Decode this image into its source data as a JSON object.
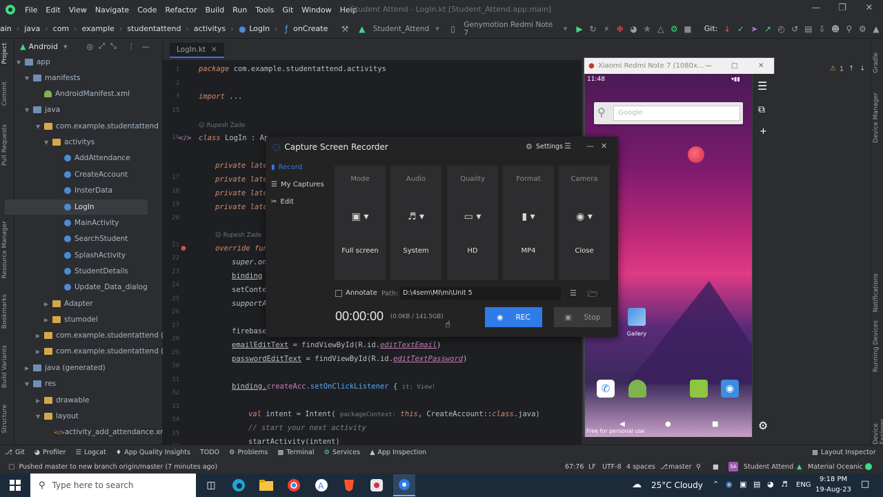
{
  "menu": {
    "items": [
      "File",
      "Edit",
      "View",
      "Navigate",
      "Code",
      "Refactor",
      "Build",
      "Run",
      "Tools",
      "Git",
      "Window",
      "Help"
    ],
    "window_title": "Student Attend - LogIn.kt [Student_Attend.app.main]"
  },
  "navbar": {
    "crumbs": [
      "ain",
      "java",
      "com",
      "example",
      "studentattend",
      "activitys",
      "LogIn",
      "onCreate"
    ],
    "config": "Student_Attend",
    "device": "Genymotion Redmi Note 7",
    "git_label": "Git:"
  },
  "left_tabs": [
    "Project",
    "Commit",
    "Pull Requests",
    "Resource Manager",
    "Bookmarks",
    "Build Variants",
    "Structure"
  ],
  "right_tabs": [
    "Gradle",
    "Device Manager",
    "Notifications",
    "Running Devices",
    "Device Explorer"
  ],
  "project": {
    "view": "Android",
    "tree": [
      {
        "label": "app",
        "type": "folder"
      },
      {
        "label": "manifests",
        "type": "folder"
      },
      {
        "label": "AndroidManifest.xml",
        "type": "android"
      },
      {
        "label": "java",
        "type": "folder"
      },
      {
        "label": "com.example.studentattend",
        "type": "folder"
      },
      {
        "label": "activitys",
        "type": "folder"
      },
      {
        "label": "AddAttendance",
        "type": "class"
      },
      {
        "label": "CreateAccount",
        "type": "class"
      },
      {
        "label": "InsterData",
        "type": "class"
      },
      {
        "label": "LogIn",
        "type": "class"
      },
      {
        "label": "MainActivity",
        "type": "class"
      },
      {
        "label": "SearchStudent",
        "type": "class"
      },
      {
        "label": "SplashActivity",
        "type": "class"
      },
      {
        "label": "StudentDetails",
        "type": "class"
      },
      {
        "label": "Update_Data_dialog",
        "type": "class"
      },
      {
        "label": "Adapter",
        "type": "folder"
      },
      {
        "label": "stumodel",
        "type": "folder"
      },
      {
        "label": "com.example.studentattend (androi",
        "type": "folder"
      },
      {
        "label": "com.example.studentattend (test)",
        "type": "folder"
      },
      {
        "label": "java (generated)",
        "type": "folder"
      },
      {
        "label": "res",
        "type": "folder"
      },
      {
        "label": "drawable",
        "type": "folder"
      },
      {
        "label": "layout",
        "type": "folder"
      },
      {
        "label": "activity_add_attendance.xml",
        "type": "xml"
      }
    ]
  },
  "editor": {
    "tab": "LogIn.kt",
    "line_numbers": [
      "1",
      "2",
      "3",
      "15",
      "",
      "16",
      "",
      "",
      "17",
      "18",
      "19",
      "20",
      "",
      "21",
      "22",
      "23",
      "24",
      "25",
      "26",
      "27",
      "28",
      "29",
      "30",
      "31",
      "32",
      "33",
      "34",
      "35",
      "36"
    ],
    "author": "Rupesh Zade",
    "package_kw": "package",
    "package_name": "com.example.studentattend.activitys",
    "import_kw": "import",
    "import_rest": "...",
    "class_kw": "class",
    "class_line": "LogIn : Ap",
    "private_kw": "private",
    "late": "late",
    "override_kw": "override",
    "fun_kw": "fun",
    "super_on": "super.on",
    "binding": "binding",
    "setConte": "setConte",
    "supportA": "supportA",
    "firebase": "firebase",
    "email_lhs": "emailEditText",
    "password_lhs": "passwordEditText",
    "eq": "=",
    "findView": "findViewById",
    "r_id": "R.id.",
    "email_id": "editTextEmail",
    "password_id": "editTextPassword",
    "close_paren": ")",
    "binding_dot": "binding.",
    "create_acc": "createAcc",
    "listener": ".setOnClickListener",
    "brace": "{",
    "it_hint": "it: View!",
    "val_kw": "val",
    "intent_decl": "intent",
    "intent_ctor": "Intent(",
    "pkg_hint": "packageContext:",
    "this_kw": "this",
    "create_account_ref": ", CreateAccount::",
    "class_ref": "class",
    "java_ref": ".java)",
    "comment": "// start your next activity",
    "start_activity": "startActivity(intent)"
  },
  "emulator": {
    "window_title": "Xiaomi Redmi Note 7 (1080x...",
    "time": "11:48",
    "search_placeholder": "Google",
    "gallery_label": "Gallery",
    "watermark": "Free for personal use"
  },
  "recorder": {
    "title": "Capture Screen Recorder",
    "settings": "Settings",
    "nav": [
      "Record",
      "My Captures",
      "Edit"
    ],
    "cards": [
      {
        "label": "Mode",
        "value": "Full screen",
        "icon": "fullscreen-icon"
      },
      {
        "label": "Audio",
        "value": "System",
        "icon": "speaker-icon"
      },
      {
        "label": "Quality",
        "value": "HD",
        "icon": "monitor-icon"
      },
      {
        "label": "Format",
        "value": "MP4",
        "icon": "file-icon"
      },
      {
        "label": "Camera",
        "value": "Close",
        "icon": "webcam-icon"
      }
    ],
    "annotate": "Annotate",
    "path_label": "Path:",
    "path_value": "D:\\4sem\\MI\\mi\\Unit 5",
    "timer": "00:00:00",
    "size": "(0.0KB / 141.5GB)",
    "rec_button": "REC",
    "stop_button": "Stop",
    "accent": "#2f7be8"
  },
  "toolwindows": [
    "Git",
    "Profiler",
    "Logcat",
    "App Quality Insights",
    "TODO",
    "Problems",
    "Terminal",
    "Services",
    "App Inspection",
    "Layout Inspector"
  ],
  "status": {
    "message": "Pushed master to new branch origin/master (7 minutes ago)",
    "position": "67:76",
    "line_sep": "LF",
    "encoding": "UTF-8",
    "indent": "4 spaces",
    "branch": "master",
    "project": "Student Attend",
    "theme": "Material Oceanic"
  },
  "taskbar": {
    "search_placeholder": "Type here to search",
    "weather": "25°C  Cloudy",
    "lang": "ENG",
    "time": "9:18 PM",
    "date": "19-Aug-23"
  },
  "warning_count": "1"
}
